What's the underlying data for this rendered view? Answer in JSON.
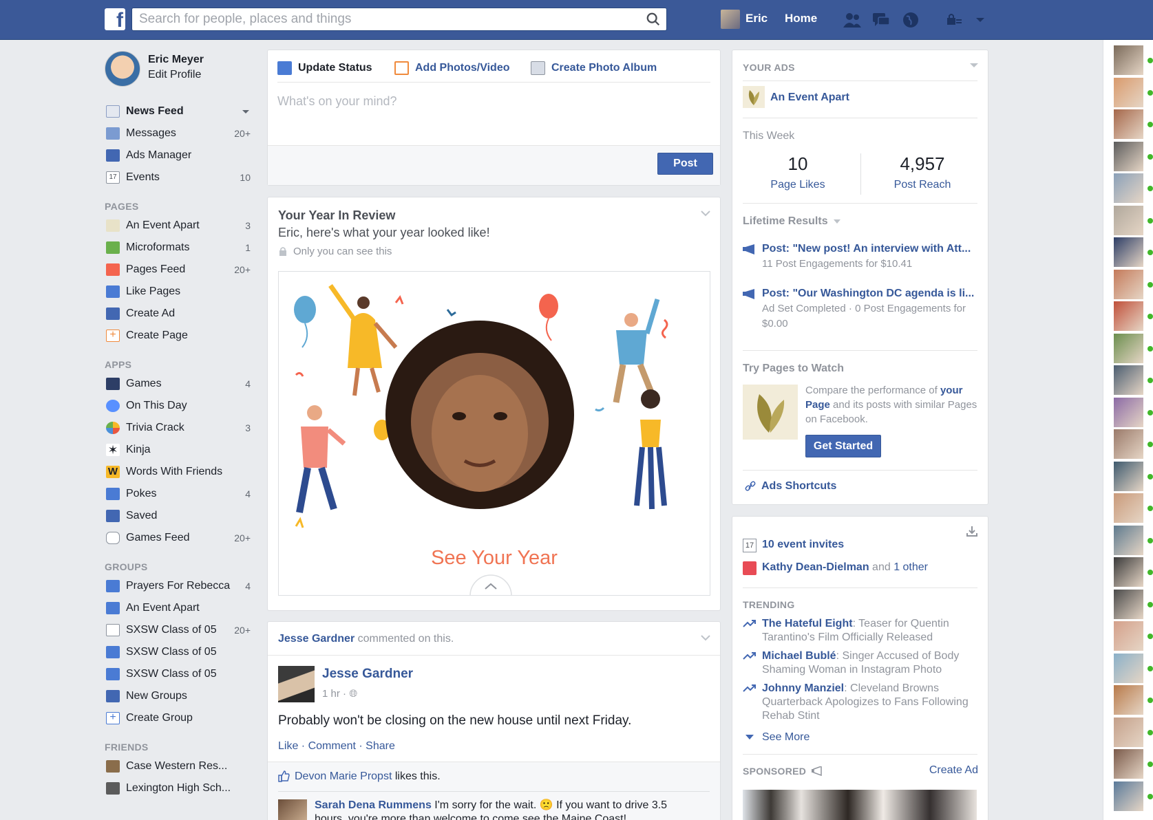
{
  "topbar": {
    "logo": "f",
    "search_placeholder": "Search for people, places and things",
    "user_name": "Eric",
    "home_label": "Home",
    "icons": [
      "friend-requests-icon",
      "messages-icon",
      "notifications-globe-icon",
      "privacy-shortcuts-icon",
      "account-menu-caret-icon"
    ]
  },
  "profile": {
    "name": "Eric Meyer",
    "edit_label": "Edit Profile"
  },
  "nav": {
    "favorites": [
      {
        "label": "News Feed",
        "count": "",
        "icon": "news-feed-icon"
      },
      {
        "label": "Messages",
        "count": "20+",
        "icon": "messages-icon"
      },
      {
        "label": "Ads Manager",
        "count": "",
        "icon": "ads-manager-icon"
      },
      {
        "label": "Events",
        "count": "10",
        "icon": "calendar-icon"
      }
    ],
    "pages_heading": "PAGES",
    "pages": [
      {
        "label": "An Event Apart",
        "count": "3",
        "icon": "event-apart-leaf-icon"
      },
      {
        "label": "Microformats",
        "count": "1",
        "icon": "microformats-icon"
      },
      {
        "label": "Pages Feed",
        "count": "20+",
        "icon": "pages-feed-icon"
      },
      {
        "label": "Like Pages",
        "count": "",
        "icon": "like-pages-icon"
      },
      {
        "label": "Create Ad",
        "count": "",
        "icon": "create-ad-icon"
      },
      {
        "label": "Create Page",
        "count": "",
        "icon": "create-page-icon"
      }
    ],
    "apps_heading": "APPS",
    "apps": [
      {
        "label": "Games",
        "count": "4",
        "icon": "games-icon"
      },
      {
        "label": "On This Day",
        "count": "",
        "icon": "clock-icon"
      },
      {
        "label": "Trivia Crack",
        "count": "3",
        "icon": "trivia-crack-icon"
      },
      {
        "label": "Kinja",
        "count": "",
        "icon": "kinja-icon"
      },
      {
        "label": "Words With Friends",
        "count": "",
        "icon": "words-with-friends-icon"
      },
      {
        "label": "Pokes",
        "count": "4",
        "icon": "pokes-icon"
      },
      {
        "label": "Saved",
        "count": "",
        "icon": "bookmark-icon"
      },
      {
        "label": "Games Feed",
        "count": "20+",
        "icon": "gamepad-icon"
      }
    ],
    "groups_heading": "GROUPS",
    "groups": [
      {
        "label": "Prayers For Rebecca",
        "count": "4",
        "icon": "group-icon"
      },
      {
        "label": "An Event Apart",
        "count": "",
        "icon": "group-icon"
      },
      {
        "label": "SXSW Class of 05",
        "count": "20+",
        "icon": "document-icon"
      },
      {
        "label": "SXSW Class of 05",
        "count": "",
        "icon": "group-icon"
      },
      {
        "label": "SXSW Class of 05",
        "count": "",
        "icon": "group-icon"
      },
      {
        "label": "New Groups",
        "count": "",
        "icon": "new-groups-icon"
      },
      {
        "label": "Create Group",
        "count": "",
        "icon": "create-group-icon"
      }
    ],
    "friends_heading": "FRIENDS",
    "friends": [
      {
        "label": "Case Western Res...",
        "count": "",
        "icon": "school-icon"
      },
      {
        "label": "Lexington High Sch...",
        "count": "",
        "icon": "school-icon"
      }
    ]
  },
  "composer": {
    "tab_status": "Update Status",
    "tab_photos": "Add Photos/Video",
    "tab_album": "Create Photo Album",
    "placeholder": "What's on your mind?",
    "post_label": "Post"
  },
  "year_review": {
    "title": "Your Year In Review",
    "subtitle": "Eric, here's what your year looked like!",
    "privacy": "Only you can see this",
    "cta": "See Your Year"
  },
  "story": {
    "header_name": "Jesse Gardner",
    "header_action": " commented on this.",
    "author": "Jesse Gardner",
    "time": "1 hr · ",
    "text": "Probably won't be closing on the new house until next Friday.",
    "actions": [
      "Like",
      "Comment",
      "Share"
    ],
    "like_name": "Devon Marie Propst",
    "like_suffix": " likes this.",
    "comment_author": "Sarah Dena Rummens",
    "comment_text": " I'm sorry for the wait. 🙁 If you want to drive 3.5 hours, you're more than welcome to come see the Maine Coast!"
  },
  "ads_panel": {
    "heading": "YOUR ADS",
    "page_name": "An Event Apart",
    "this_week": "This Week",
    "stats": [
      {
        "value": "10",
        "label": "Page Likes"
      },
      {
        "value": "4,957",
        "label": "Post Reach"
      }
    ],
    "lifetime_heading": "Lifetime Results",
    "results": [
      {
        "title": "Post: \"New post! An interview with Att...",
        "sub": "11 Post Engagements for $10.41"
      },
      {
        "title": "Post: \"Our Washington DC agenda is li...",
        "sub": "Ad Set Completed · 0 Post Engagements for $0.00"
      }
    ],
    "try_heading": "Try Pages to Watch",
    "try_text_1": "Compare the performance of ",
    "try_text_your": "your",
    "try_text_page": "Page",
    "try_text_2": " and its posts with similar Pages on Facebook.",
    "get_started": "Get Started",
    "shortcuts": "Ads Shortcuts"
  },
  "events_panel": {
    "event_invites": "10 event invites",
    "birthday_name": "Kathy Dean-Dielman",
    "birthday_suffix": " and ",
    "birthday_other": "1 other",
    "trending_heading": "TRENDING",
    "trending": [
      {
        "topic": "The Hateful Eight",
        "text": ": Teaser for Quentin Tarantino's Film Officially Released"
      },
      {
        "topic": "Michael Bublé",
        "text": ": Singer Accused of Body Shaming Woman in Instagram Photo"
      },
      {
        "topic": "Johnny Manziel",
        "text": ": Cleveland Browns Quarterback Apologizes to Fans Following Rehab Stint"
      }
    ],
    "see_more": "See More",
    "sponsored_heading": "SPONSORED",
    "create_ad": "Create Ad"
  },
  "chat": {
    "online_count": 24
  },
  "colors": {
    "brand_blue": "#3b5998",
    "link_blue": "#365899",
    "button_blue": "#4267b2",
    "page_bg": "#e9ebee",
    "see_your_year": "#f07453",
    "online_green": "#42b72a"
  }
}
